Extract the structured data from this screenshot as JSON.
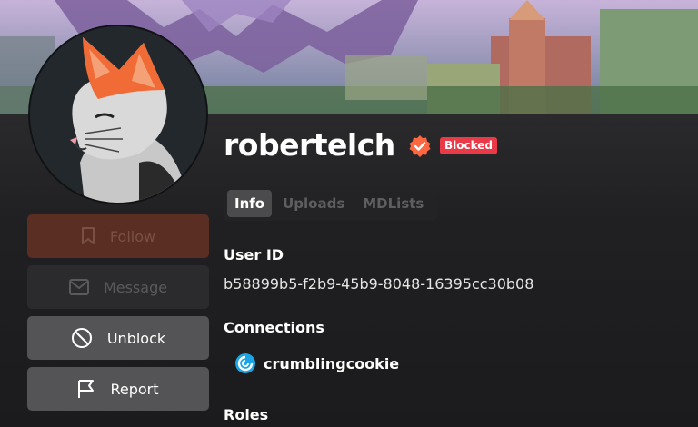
{
  "profile": {
    "username": "robertelch",
    "status_badge": "Blocked",
    "accent": "#ff6740"
  },
  "tabs": [
    {
      "label": "Info",
      "active": true
    },
    {
      "label": "Uploads",
      "active": false
    },
    {
      "label": "MDLists",
      "active": false
    }
  ],
  "actions": {
    "follow": "Follow",
    "message": "Message",
    "unblock": "Unblock",
    "report": "Report"
  },
  "info": {
    "user_id_label": "User ID",
    "user_id": "b58899b5-f2b9-45b9-8048-16395cc30b08",
    "connections_label": "Connections",
    "connection_name": "crumblingcookie",
    "roles_label": "Roles"
  },
  "icons": [
    "verified-badge-icon",
    "bookmark-icon",
    "mail-icon",
    "block-icon",
    "flag-icon",
    "crumbling-cookie-logo-icon"
  ]
}
